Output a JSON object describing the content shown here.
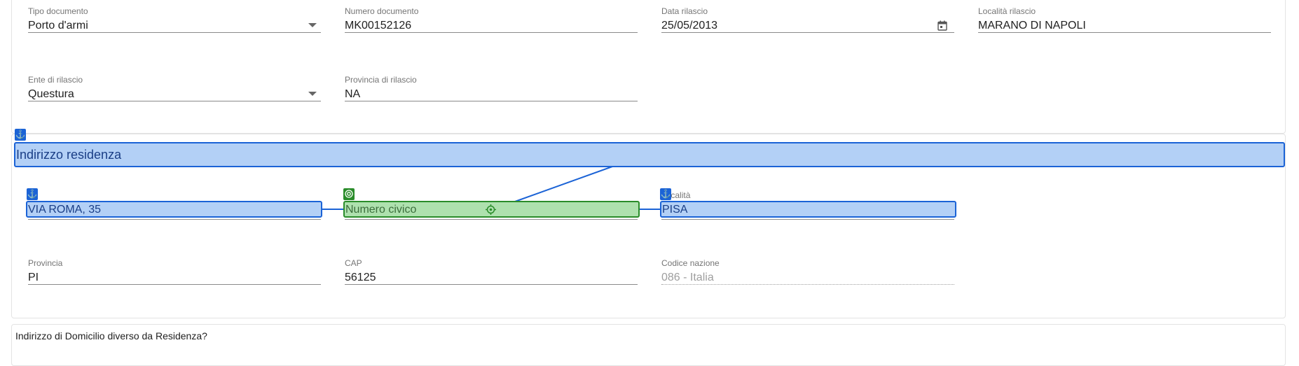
{
  "documento": {
    "tipo": {
      "label": "Tipo documento",
      "value": "Porto d'armi"
    },
    "numero": {
      "label": "Numero documento",
      "value": "MK00152126"
    },
    "data_rilascio": {
      "label": "Data rilascio",
      "value": "25/05/2013"
    },
    "localita_rilascio": {
      "label": "Località rilascio",
      "value": "MARANO DI NAPOLI"
    },
    "ente_rilascio": {
      "label": "Ente di rilascio",
      "value": "Questura"
    },
    "provincia_rilascio": {
      "label": "Provincia di rilascio",
      "value": "NA"
    }
  },
  "residenza": {
    "section_title": "Indirizzo residenza",
    "indirizzo": {
      "value": "VIA ROMA, 35"
    },
    "numero_civico": {
      "placeholder": "Numero civico"
    },
    "localita": {
      "label": "Località",
      "value": "PISA"
    },
    "provincia": {
      "label": "Provincia",
      "value": "PI"
    },
    "cap": {
      "label": "CAP",
      "value": "56125"
    },
    "codice_nazione": {
      "label": "Codice nazione",
      "value": "086 - Italia"
    }
  },
  "domicilio": {
    "question": "Indirizzo di Domicilio diverso da Residenza?"
  },
  "overlay": {
    "anchor_icon": "anchor-icon",
    "target_icon": "target-icon",
    "crosshair_icon": "crosshair-icon",
    "anchor_color": "#1b63d6",
    "target_color": "#2a8c2a"
  }
}
